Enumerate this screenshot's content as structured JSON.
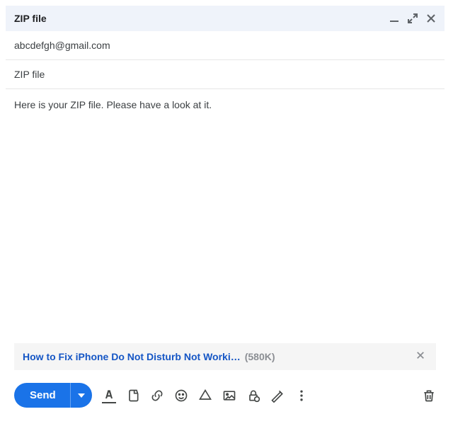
{
  "header": {
    "title": "ZIP file"
  },
  "recipient": "abcdefgh@gmail.com",
  "subject": "ZIP file",
  "body_text": "Here is your ZIP file. Please have a look at it.",
  "attachment": {
    "name": "How to Fix iPhone Do Not Disturb Not Worki…",
    "size": "(580K)"
  },
  "colors": {
    "send_bg": "#1a73e8",
    "header_bg": "#eff3fa",
    "link": "#1556c5"
  },
  "send": {
    "label": "Send"
  }
}
